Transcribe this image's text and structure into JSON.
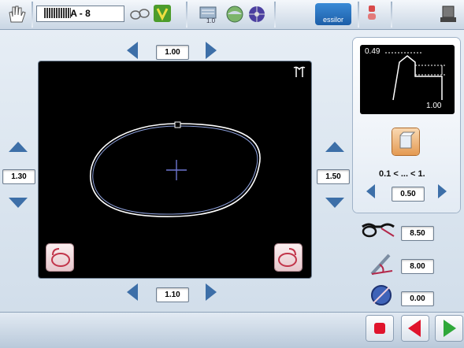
{
  "toolbar": {
    "job_number": "A - 8",
    "logo_text": "essilor",
    "small_label": "1.0"
  },
  "controls": {
    "top_value": "1.00",
    "left_value": "1.30",
    "right_value": "1.50",
    "bottom_value": "1.10"
  },
  "mini_preview": {
    "top_value": "0.49",
    "bottom_value": "1.00"
  },
  "right_panel": {
    "range_text": "0.1 < ... < 1.",
    "step_value": "0.50"
  },
  "params": {
    "frame_value": "8.50",
    "angle_value": "8.00",
    "third_value": "0.00"
  },
  "colors": {
    "accent": "#3d6fa8",
    "stop": "#e0142c",
    "back": "#e0142c",
    "forward": "#2fa83a"
  }
}
